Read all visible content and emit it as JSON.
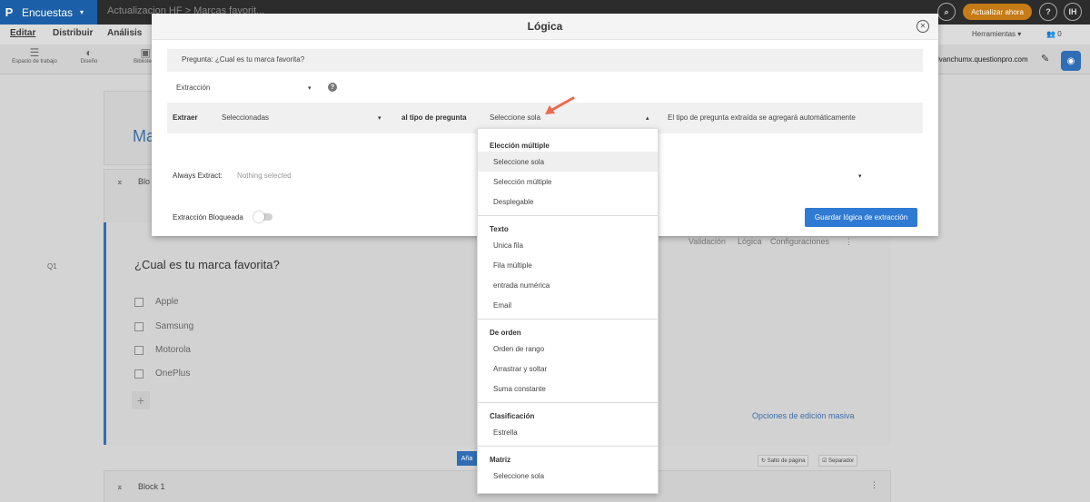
{
  "topbar": {
    "logo": "P",
    "app_name": "Encuestas",
    "app_caret": "▾",
    "breadcrumb": "Actualizacion HF  >  Marcas favorit...",
    "search_glyph": "⌕",
    "upgrade_label": "Actualizar ahora",
    "help_glyph": "?",
    "user_initials": "IH"
  },
  "menubar": {
    "items": [
      "Editar",
      "Distribuir",
      "Análisis"
    ],
    "tools_label": "Herramientas",
    "tools_caret": "▾",
    "user_count": "0"
  },
  "toolbar": {
    "items": [
      {
        "label": "Espacio de trabajo",
        "icon": "☰"
      },
      {
        "label": "Diseño",
        "icon": "◐"
      },
      {
        "label": "Biblioteca",
        "icon": "▣"
      }
    ],
    "domain": "ivanchumx.questionpro.com",
    "edit_glyph": "✎",
    "view_glyph": "◉"
  },
  "survey": {
    "title_fragment": "Ma",
    "block_label_top": "Blo",
    "question_number": "Q1",
    "question_text": "¿Cual es tu marca favorita?",
    "options": [
      "Apple",
      "Samsung",
      "Motorola",
      "OnePlus"
    ],
    "add_glyph": "+",
    "question_tabs": [
      "Validación",
      "Lógica",
      "Configuraciones"
    ],
    "more_glyph": "⋮",
    "bulk_edit": "Opciones de edición masiva",
    "add_chip": "Aña",
    "page_break": "Salto de página",
    "separator": "Separador",
    "block_bottom": "Block 1",
    "collapse_glyph": "⌅"
  },
  "modal": {
    "title": "Lógica",
    "close_glyph": "✕",
    "question_line": "Pregunta: ¿Cual es tu marca favorita?",
    "extraction_select": "Extracción",
    "select_caret": "▾",
    "help_glyph": "?",
    "extract_label": "Extraer",
    "extract_value": "Seleccionadas",
    "to_type_label": "al tipo de pregunta",
    "type_value": "Seleccione sola",
    "type_caret": "▴",
    "auto_note": "El tipo de pregunta extraída se agregará automáticamente",
    "always_extract_label": "Always Extract:",
    "always_extract_value": "Nothing selected",
    "locked_label": "Extracción Bloqueada",
    "locked_on": false,
    "save_button": "Guardar lógica de extracción"
  },
  "dropdown": {
    "groups": [
      {
        "name": "Elección múltiple",
        "items": [
          "Seleccione sola",
          "Selección múltiple",
          "Desplegable"
        ]
      },
      {
        "name": "Texto",
        "items": [
          "Unica fila",
          "Fila múltiple",
          "entrada numérica",
          "Email"
        ]
      },
      {
        "name": "De orden",
        "items": [
          "Orden de rango",
          "Arrastrar y soltar",
          "Suma constante"
        ]
      },
      {
        "name": "Clasificación",
        "items": [
          "Estrella"
        ]
      },
      {
        "name": "Matriz",
        "items": [
          "Seleccione sola"
        ]
      }
    ],
    "selected": "Seleccione sola"
  },
  "colors": {
    "accent": "#2f7ad3",
    "annotation_arrow": "#ec6a4c",
    "upgrade": "#c67b16"
  }
}
